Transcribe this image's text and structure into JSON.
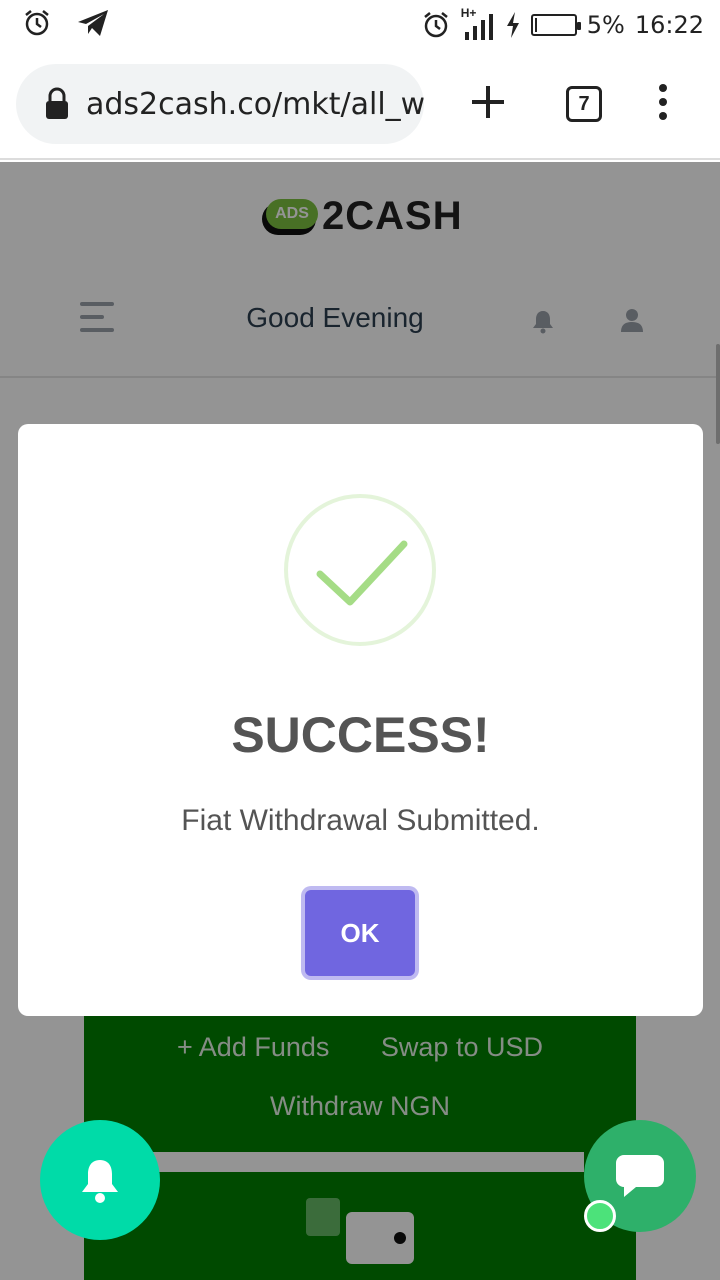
{
  "status_bar": {
    "battery_percent_label": "5%",
    "battery_level": 0.05,
    "time": "16:22",
    "network_label": "H+",
    "icons": [
      "alarm-icon",
      "telegram-icon",
      "alarm-icon",
      "signal-icon",
      "charging-icon",
      "battery-icon"
    ]
  },
  "browser": {
    "url": "ads2cash.co/mkt/all_w",
    "tab_count": "7",
    "icons": [
      "lock-icon",
      "new-tab-plus-icon",
      "tab-switcher-icon",
      "more-menu-icon"
    ]
  },
  "site": {
    "logo_badge": "ADS",
    "logo_text": "2CASH",
    "greeting": "Good Evening",
    "brand_color": "#7cc241",
    "wallet": {
      "add_funds": "+ Add Funds",
      "swap": "Swap to USD",
      "withdraw": "Withdraw NGN",
      "card_color": "#008000"
    }
  },
  "dialog": {
    "title": "SUCCESS!",
    "message": "Fiat Withdrawal Submitted.",
    "ok_label": "OK",
    "accent_color": "#7066e0",
    "check_color": "#a5dc86"
  },
  "floating": {
    "bell_color": "#00dba8",
    "chat_color": "#2eb06a",
    "online_color": "#4ce27a"
  }
}
